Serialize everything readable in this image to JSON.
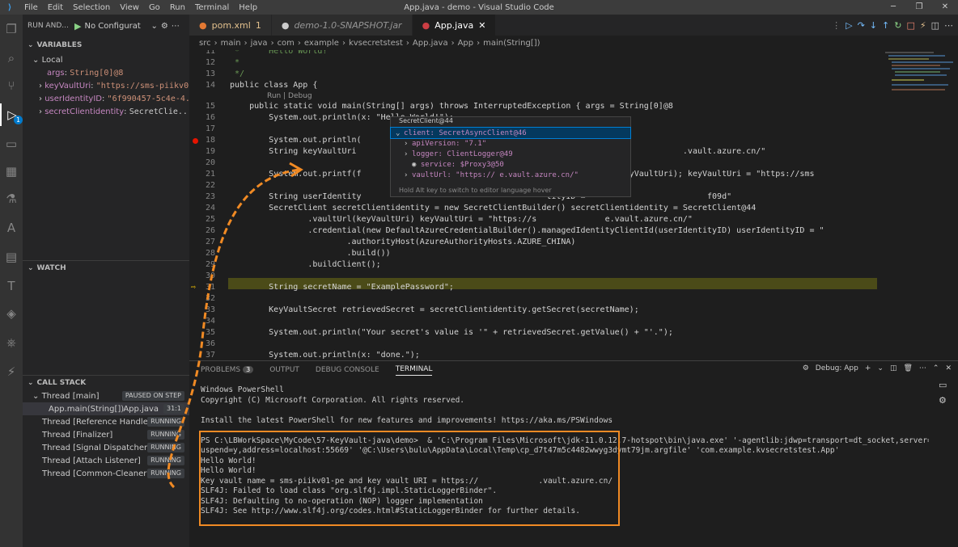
{
  "titlebar": {
    "menu": [
      "File",
      "Edit",
      "Selection",
      "View",
      "Go",
      "Run",
      "Terminal",
      "Help"
    ],
    "title": "App.java - demo - Visual Studio Code"
  },
  "activity": {
    "badge": "1"
  },
  "sidebar": {
    "run_label": "RUN AND...",
    "config": "No Configurat",
    "variables_title": "VARIABLES",
    "local_title": "Local",
    "variables": [
      {
        "name": "args",
        "value": "String[0]@8"
      },
      {
        "name": "keyVaultUri",
        "value": "\"https://sms-piikv0..."
      },
      {
        "name": "userIdentityID",
        "value": "\"6f990457-5c4e-4..."
      },
      {
        "name": "secretClientidentity",
        "value": "SecretClie..."
      }
    ],
    "watch_title": "WATCH",
    "callstack_title": "CALL STACK",
    "thread_main": "Thread [main]",
    "thread_main_status": "PAUSED ON STEP",
    "frame": "App.main(String[])",
    "frame_file": "App.java",
    "frame_pos": "31:1",
    "threads": [
      {
        "name": "Thread [Reference Handler]",
        "status": "RUNNING"
      },
      {
        "name": "Thread [Finalizer]",
        "status": "RUNNING"
      },
      {
        "name": "Thread [Signal Dispatcher]",
        "status": "RUNNING"
      },
      {
        "name": "Thread [Attach Listener]",
        "status": "RUNNING"
      },
      {
        "name": "Thread [Common-Cleaner]",
        "status": "RUNNING"
      }
    ]
  },
  "tabs": [
    {
      "label": "pom.xml",
      "suffix": "1"
    },
    {
      "label": "demo-1.0-SNAPSHOT.jar",
      "suffix": ""
    },
    {
      "label": "App.java",
      "suffix": ""
    }
  ],
  "breadcrumb": [
    "src",
    "main",
    "java",
    "com",
    "example",
    "kvsecretstest",
    "App.java",
    "App",
    "main(String[])"
  ],
  "codelens": "Run | Debug",
  "code": [
    {
      "n": "11",
      "t": " *      Hello World!"
    },
    {
      "n": "12",
      "t": " *"
    },
    {
      "n": "13",
      "t": " */"
    },
    {
      "n": "14",
      "t": "public class App {"
    },
    {
      "n": "15",
      "t": "    public static void main(String[] args) throws InterruptedException { args = String[0]@8"
    },
    {
      "n": "16",
      "t": "        System.out.println(x: \"Hello World!\");"
    },
    {
      "n": "17",
      "t": ""
    },
    {
      "n": "18",
      "t": "        System.out.println("
    },
    {
      "n": "19",
      "t": "        String keyVaultUri                                      Uri = \"https://              .vault.azure.cn/\""
    },
    {
      "n": "20",
      "t": ""
    },
    {
      "n": "21",
      "t": "        System.out.printf(f                                       URI = %s \\n\", keyVaultUri); keyVaultUri = \"https://sms"
    },
    {
      "n": "22",
      "t": ""
    },
    {
      "n": "23",
      "t": "        String userIdentity                                      tityID = \"                       f09d\""
    },
    {
      "n": "24",
      "t": "        SecretClient secretClientidentity = new SecretClientBuilder() secretClientidentity = SecretClient@44"
    },
    {
      "n": "25",
      "t": "                .vaultUrl(keyVaultUri) keyVaultUri = \"https://s              e.vault.azure.cn/\""
    },
    {
      "n": "26",
      "t": "                .credential(new DefaultAzureCredentialBuilder().managedIdentityClientId(userIdentityID) userIdentityID = \""
    },
    {
      "n": "27",
      "t": "                        .authorityHost(AzureAuthorityHosts.AZURE_CHINA)"
    },
    {
      "n": "28",
      "t": "                        .build())"
    },
    {
      "n": "29",
      "t": "                .buildClient();"
    },
    {
      "n": "30",
      "t": ""
    },
    {
      "n": "31",
      "t": "        String secretName = \"ExamplePassword\";"
    },
    {
      "n": "32",
      "t": ""
    },
    {
      "n": "33",
      "t": "        KeyVaultSecret retrievedSecret = secretClientidentity.getSecret(secretName);"
    },
    {
      "n": "34",
      "t": ""
    },
    {
      "n": "35",
      "t": "        System.out.println(\"Your secret's value is '\" + retrievedSecret.getValue() + \"'.\");"
    },
    {
      "n": "36",
      "t": ""
    },
    {
      "n": "37",
      "t": "        System.out.println(x: \"done.\");"
    }
  ],
  "hover": {
    "header": "SecretClient@44",
    "rows": [
      {
        "label": "client: SecretAsyncClient@46"
      },
      {
        "label": "apiVersion: \"7.1\""
      },
      {
        "label": "logger: ClientLogger@49"
      },
      {
        "label": "service: $Proxy3@50"
      },
      {
        "label": "vaultUrl: \"https://               e.vault.azure.cn/\""
      }
    ],
    "footer": "Hold Alt key to switch to editor language hover"
  },
  "panel": {
    "tabs": [
      "PROBLEMS",
      "OUTPUT",
      "DEBUG CONSOLE",
      "TERMINAL"
    ],
    "problems_count": "3",
    "debug_select": "Debug: App",
    "terminal": [
      "Windows PowerShell",
      "Copyright (C) Microsoft Corporation. All rights reserved.",
      "",
      "Install the latest PowerShell for new features and improvements! https://aka.ms/PSWindows",
      "",
      "PS C:\\LBWorkSpace\\MyCode\\57-KeyVault-java\\demo>  & 'C:\\Program Files\\Microsoft\\jdk-11.0.12.7-hotspot\\bin\\java.exe' '-agentlib:jdwp=transport=dt_socket,server=n,s",
      "uspend=y,address=localhost:55669' '@C:\\Users\\bulu\\AppData\\Local\\Temp\\cp_d7t47m5c4482wwyg3dymt79jm.argfile' 'com.example.kvsecretstest.App'",
      "Hello World!",
      "Hello World!",
      "Key vault name = sms-piikv01-pe and key vault URI = https://             .vault.azure.cn/",
      "SLF4J: Failed to load class \"org.slf4j.impl.StaticLoggerBinder\".",
      "SLF4J: Defaulting to no-operation (NOP) logger implementation",
      "SLF4J: See http://www.slf4j.org/codes.html#StaticLoggerBinder for further details."
    ]
  },
  "colors": {
    "accent": "#007acc",
    "annotation": "#f08a24",
    "current_line": "#4b4b18",
    "breakpoint": "#e51400"
  }
}
